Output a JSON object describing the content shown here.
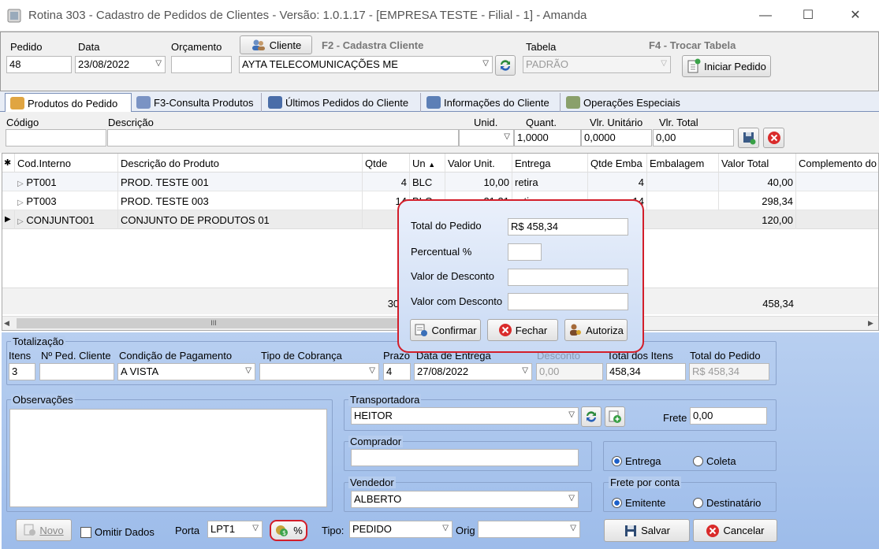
{
  "window": {
    "title": "Rotina 303 - Cadastro de Pedidos de Clientes - Versão: 1.0.1.17 - [EMPRESA TESTE - Filial - 1] - Amanda"
  },
  "header": {
    "pedido_label": "Pedido",
    "pedido_value": "48",
    "data_label": "Data",
    "data_value": "23/08/2022",
    "orcamento_label": "Orçamento",
    "orcamento_value": "",
    "cliente_btn": "Cliente",
    "f2_label": "F2 - Cadastra Cliente",
    "cliente_value": "AYTA TELECOMUNICAÇÕES ME",
    "tabela_label": "Tabela",
    "tabela_value": "PADRÃO",
    "f4_label": "F4 - Trocar Tabela",
    "iniciar_btn": "Iniciar Pedido"
  },
  "tabs": [
    {
      "label": "Produtos do Pedido"
    },
    {
      "label": "F3-Consulta Produtos"
    },
    {
      "label": "Últimos Pedidos do Cliente"
    },
    {
      "label": "Informações do Cliente"
    },
    {
      "label": "Operações Especiais"
    }
  ],
  "product_entry": {
    "codigo": "Código",
    "descricao": "Descrição",
    "unid": "Unid.",
    "quant": "Quant.",
    "vlr_unit": "Vlr. Unitário",
    "vlr_total": "Vlr. Total",
    "quant_value": "1,0000",
    "vlr_unit_value": "0,0000",
    "vlr_total_value": "0,00"
  },
  "grid": {
    "marker": "✱",
    "headers": [
      "Cod.Interno",
      "Descrição do Produto",
      "Qtde",
      "Un",
      "Valor Unit.",
      "Entrega",
      "Qtde Emba",
      "Embalagem",
      "Valor Total",
      "Complemento do"
    ],
    "rows": [
      {
        "cod": "PT001",
        "desc": "PROD. TESTE 001",
        "qtde": "4",
        "un": "BLC",
        "vu": "10,00",
        "ent": "retira",
        "qe": "4",
        "emb": "",
        "vt": "40,00"
      },
      {
        "cod": "PT003",
        "desc": "PROD. TESTE 003",
        "qtde": "14",
        "un": "BLC",
        "vu": "21,31",
        "ent": "retira",
        "qe": "14",
        "emb": "",
        "vt": "298,34"
      },
      {
        "cod": "CONJUNTO01",
        "desc": "CONJUNTO DE PRODUTOS 01",
        "qtde": "",
        "un": "",
        "vu": "",
        "ent": "",
        "qe": "",
        "emb": "",
        "vt": "120,00"
      }
    ],
    "footer_qtde": "30,0",
    "footer_total": "458,34",
    "scroll_thumb": "III"
  },
  "popup": {
    "total_label": "Total do Pedido",
    "total_value": "R$ 458,34",
    "perc_label": "Percentual %",
    "perc_value": "",
    "desc_label": "Valor de Desconto",
    "desc_value": "",
    "com_desc_label": "Valor com Desconto",
    "com_desc_value": "",
    "confirmar": "Confirmar",
    "fechar": "Fechar",
    "autoriza": "Autoriza"
  },
  "totalizacao": {
    "title": "Totalização",
    "itens_label": "Itens",
    "itens_value": "3",
    "nped_label": "Nº Ped. Cliente",
    "nped_value": "",
    "cond_label": "Condição de Pagamento",
    "cond_value": "A VISTA",
    "tipo_cob_label": "Tipo de Cobrança",
    "tipo_cob_value": "",
    "prazo_label": "Prazo",
    "prazo_value": "4",
    "data_ent_label": "Data de Entrega",
    "data_ent_value": "27/08/2022",
    "desconto_label": "Desconto",
    "desconto_value": "0,00",
    "total_itens_label": "Total dos Itens",
    "total_itens_value": "458,34",
    "total_ped_label": "Total do Pedido",
    "total_ped_value": "R$ 458,34"
  },
  "obs": {
    "title": "Observações",
    "value": ""
  },
  "transp": {
    "title": "Transportadora",
    "value": "HEITOR",
    "frete_label": "Frete",
    "frete_value": "0,00"
  },
  "comprador": {
    "title": "Comprador",
    "value": ""
  },
  "entrega": {
    "entrega": "Entrega",
    "coleta": "Coleta"
  },
  "vendedor": {
    "title": "Vendedor",
    "value": "ALBERTO"
  },
  "frete_conta": {
    "title": "Frete por conta",
    "emitente": "Emitente",
    "destinatario": "Destinatário"
  },
  "footer": {
    "novo": "Novo",
    "omitir": "Omitir Dados",
    "porta_label": "Porta",
    "porta_value": "LPT1",
    "percent_btn": "%",
    "tipo_label": "Tipo:",
    "tipo_value": "PEDIDO",
    "orig_label": "Orig",
    "orig_value": "",
    "salvar": "Salvar",
    "cancelar": "Cancelar"
  }
}
